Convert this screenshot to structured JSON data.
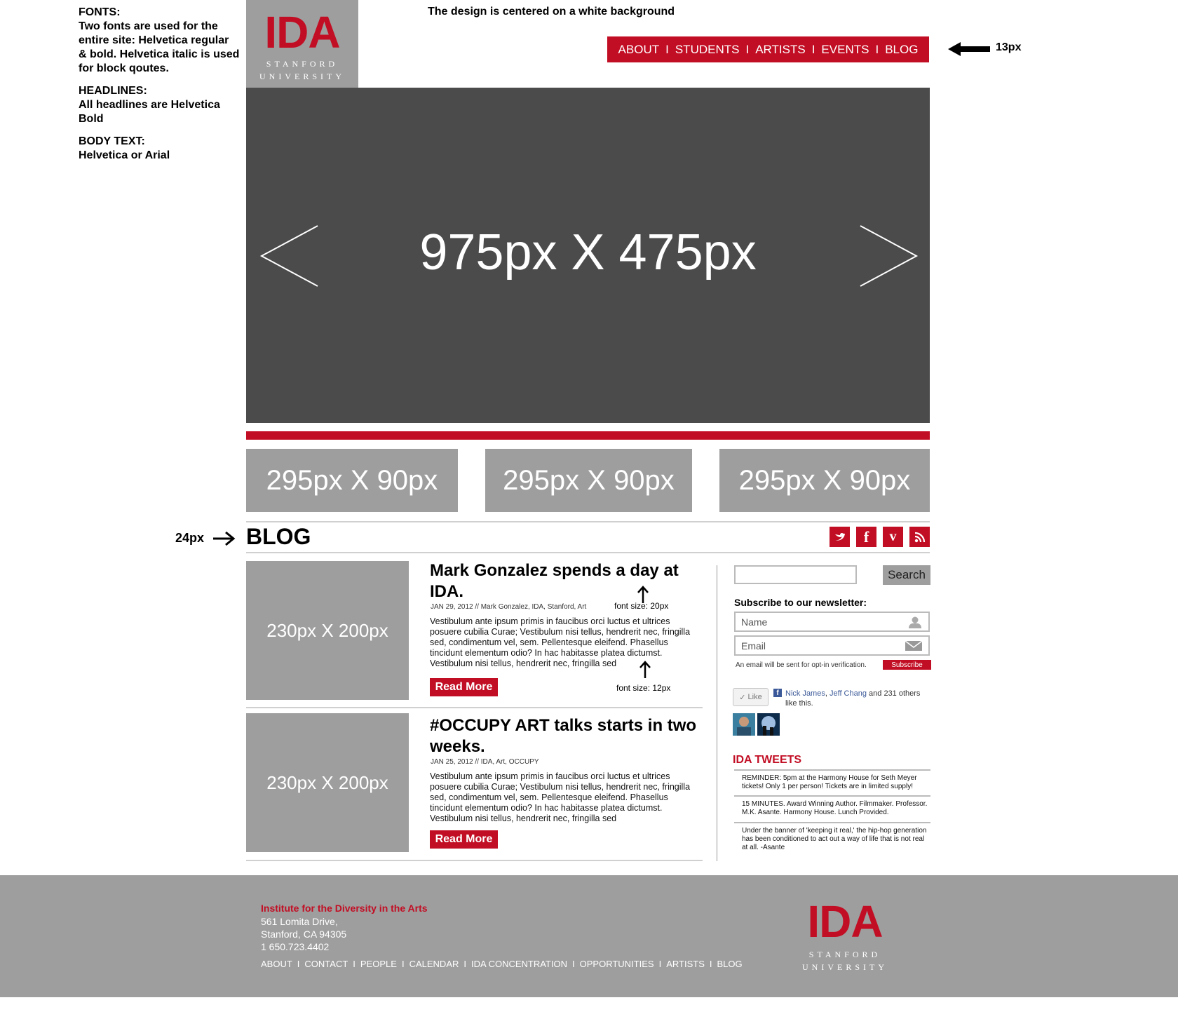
{
  "notes": {
    "fonts_heading": "FONTS:",
    "fonts_text": "Two fonts are used for the entire site: Helvetica regular & bold. Helvetica italic is used for block qoutes.",
    "headlines_heading": "HEADLINES:",
    "headlines_text": "All headlines are Helvetica Bold",
    "body_heading": "BODY TEXT:",
    "body_text": "Helvetica or Arial",
    "centered": "The design is centered on a white background",
    "nav_size": "13px",
    "blog_size": "24px",
    "title_font_size": "font size: 20px",
    "body_font_size": "font size: 12px"
  },
  "logo": {
    "main": "IDA",
    "line1": "STANFORD",
    "line2": "UNIVERSITY"
  },
  "nav": {
    "items": [
      "ABOUT",
      "STUDENTS",
      "ARTISTS",
      "EVENTS",
      "BLOG"
    ],
    "separator": "I"
  },
  "hero": {
    "label": "975px X 475px"
  },
  "thumbs": [
    "295px X 90px",
    "295px X 90px",
    "295px X 90px"
  ],
  "blog": {
    "title": "BLOG",
    "social": [
      "twitter-icon",
      "facebook-icon",
      "vimeo-icon",
      "rss-icon"
    ],
    "posts": [
      {
        "image_label": "230px X 200px",
        "title": "Mark Gonzalez spends a day at IDA.",
        "meta": "JAN 29, 2012 // Mark Gonzalez, IDA, Stanford, Art",
        "body": "Vestibulum ante ipsum primis in faucibus orci luctus et ultrices posuere cubilia Curae; Vestibulum nisi tellus, hendrerit nec, fringilla sed, condimentum vel, sem. Pellentesque eleifend. Phasellus tincidunt elementum odio? In hac habitasse platea dictumst. Vestibulum nisi tellus, hendrerit nec, fringilla sed",
        "read_more": "Read More"
      },
      {
        "image_label": "230px X 200px",
        "title": "#OCCUPY ART talks starts in two weeks.",
        "meta": "JAN 25, 2012 // IDA, Art, OCCUPY",
        "body": "Vestibulum ante ipsum primis in faucibus orci luctus et ultrices posuere cubilia Curae; Vestibulum nisi tellus, hendrerit nec, fringilla sed, condimentum vel, sem. Pellentesque eleifend. Phasellus tincidunt elementum odio? In hac habitasse platea dictumst. Vestibulum nisi tellus, hendrerit nec, fringilla sed",
        "read_more": "Read More"
      }
    ]
  },
  "sidebar": {
    "search_value": "",
    "search_button": "Search",
    "subscribe_label": "Subscribe to our newsletter:",
    "name_placeholder": "Name",
    "email_placeholder": "Email",
    "email_note": "An email will be sent for opt-in verification.",
    "subscribe_button": "Subscribe",
    "like_button": "Like",
    "like_name1": "Nick James",
    "like_sep": ", ",
    "like_name2": "Jeff Chang",
    "like_rest": " and 231 others like this.",
    "tweets_title": "IDA TWEETS",
    "tweets": [
      "REMINDER: 5pm at the Harmony House for Seth Meyer tickets! Only 1 per person! Tickets are in limited supply!",
      "15 MINUTES. Award Winning Author. Filmmaker. Professor. M.K. Asante. Harmony House. Lunch Provided.",
      "Under the banner of 'keeping it real,' the hip-hop generation has been conditioned to act out a way of life that is not real at all. -Asante"
    ]
  },
  "footer": {
    "org": "Institute for the Diversity in the Arts",
    "address1": "561 Lomita Drive,",
    "address2": "Stanford, CA 94305",
    "phone": "1 650.723.4402",
    "nav": [
      "ABOUT",
      "CONTACT",
      "PEOPLE",
      "CALENDAR",
      "IDA CONCENTRATION",
      "OPPORTUNITIES",
      "ARTISTS",
      "BLOG"
    ],
    "separator": "I"
  },
  "colors": {
    "accent": "#c20e24",
    "placeholder_gray": "#9e9e9e",
    "hero_gray": "#4b4b4b"
  }
}
